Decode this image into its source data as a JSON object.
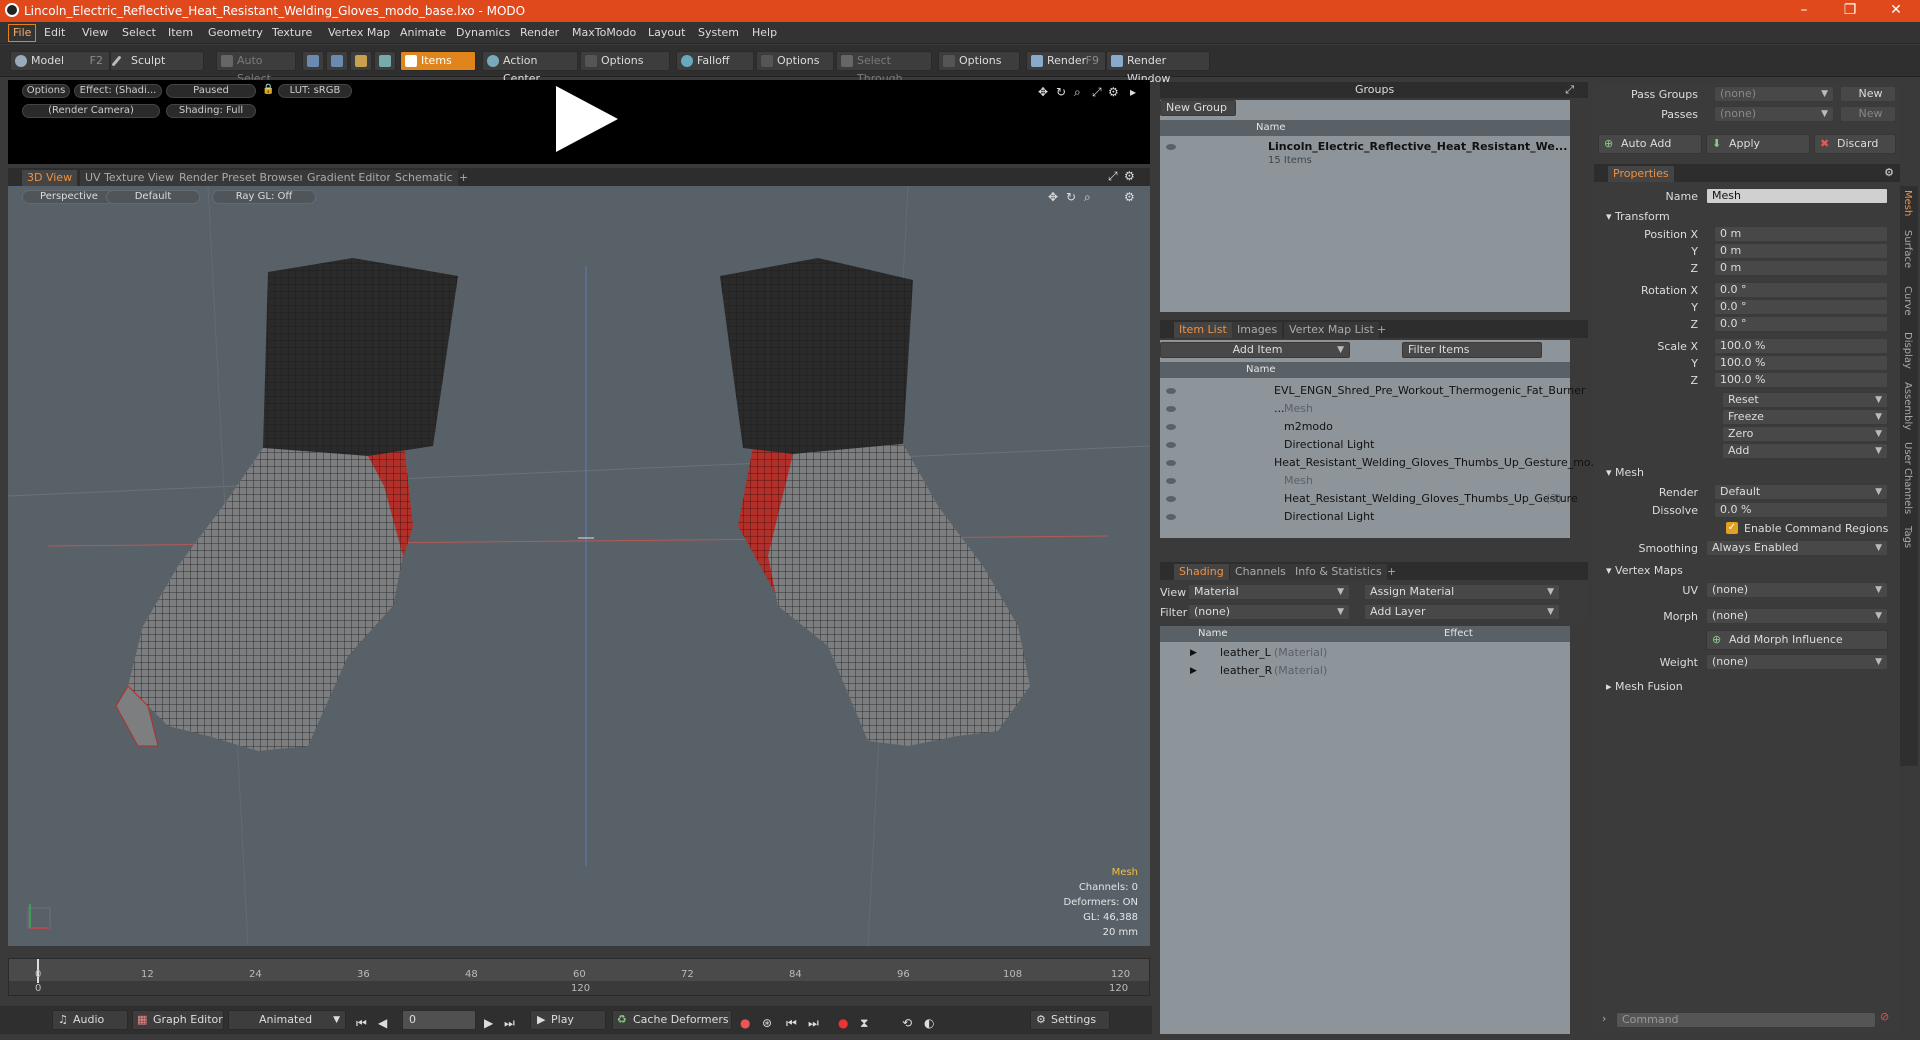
{
  "window": {
    "title": "Lincoln_Electric_Reflective_Heat_Resistant_Welding_Gloves_modo_base.lxo - MODO"
  },
  "menus": [
    "File",
    "Edit",
    "View",
    "Select",
    "Item",
    "Geometry",
    "Texture",
    "Vertex Map",
    "Animate",
    "Dynamics",
    "Render",
    "MaxToModo",
    "Layout",
    "System",
    "Help"
  ],
  "toolbar": {
    "model": "Model",
    "model_key": "F2",
    "sculpt": "Sculpt",
    "auto_select": "Auto Select",
    "items": "Items",
    "action_center": "Action Center",
    "options1": "Options",
    "falloff": "Falloff",
    "options2": "Options",
    "select_through": "Select Through",
    "options3": "Options",
    "render": "Render",
    "render_key": "F9",
    "render_window": "Render Window"
  },
  "preview": {
    "options": "Options",
    "effect": "Effect: (Shadi...",
    "paused": "Paused",
    "lut": "LUT: sRGB",
    "camera": "(Render Camera)",
    "shading": "Shading: Full"
  },
  "view_tabs": [
    "3D View",
    "UV Texture View",
    "Render Preset Browser",
    "Gradient Editor",
    "Schematic",
    "+"
  ],
  "viewport": {
    "perspective": "Perspective",
    "default": "Default",
    "raygl": "Ray GL: Off",
    "info": {
      "title": "Mesh",
      "channels": "Channels: 0",
      "deformers": "Deformers: ON",
      "gl": "GL: 46,388",
      "scale": "20 mm"
    }
  },
  "timeline": {
    "ticks": [
      "0",
      "12",
      "24",
      "36",
      "48",
      "60",
      "72",
      "84",
      "96",
      "108",
      "120"
    ],
    "sub_ticks": [
      "0",
      "120",
      "120"
    ]
  },
  "transport": {
    "audio": "Audio",
    "graph_editor": "Graph Editor",
    "animated": "Animated",
    "frame": "0",
    "play": "Play",
    "cache_deformers": "Cache Deformers",
    "settings": "Settings"
  },
  "groups": {
    "header": "Groups",
    "new_group": "New Group",
    "col_name": "Name",
    "item_name": "Lincoln_Electric_Reflective_Heat_Resistant_We...",
    "item_count": "15 Items"
  },
  "itemlist": {
    "tabs": [
      "Item List",
      "Images",
      "Vertex Map List",
      "+"
    ],
    "add_item": "Add Item",
    "filter": "Filter Items",
    "col_name": "Name",
    "rows": [
      {
        "label": "EVL_ENGN_Shred_Pre_Workout_Thermogenic_Fat_Burner ...",
        "dim": false
      },
      {
        "label": "Mesh",
        "dim": true
      },
      {
        "label": "m2modo",
        "dim": false
      },
      {
        "label": "Directional Light",
        "dim": false
      },
      {
        "label": "Heat_Resistant_Welding_Gloves_Thumbs_Up_Gesture_mo...",
        "dim": false
      },
      {
        "label": "Mesh",
        "dim": true
      },
      {
        "label": "Heat_Resistant_Welding_Gloves_Thumbs_Up_Gesture",
        "dim": false,
        "suffix": "(3)"
      },
      {
        "label": "Directional Light",
        "dim": false
      }
    ]
  },
  "shading": {
    "tabs": [
      "Shading",
      "Channels",
      "Info & Statistics",
      "+"
    ],
    "view_label": "View",
    "view_value": "Material",
    "assign": "Assign Material",
    "filter_label": "Filter",
    "filter_value": "(none)",
    "add_layer": "Add Layer",
    "col_name": "Name",
    "col_effect": "Effect",
    "rows": [
      {
        "label": "leather_L",
        "type": "(Material)"
      },
      {
        "label": "leather_R",
        "type": "(Material)"
      }
    ]
  },
  "props": {
    "pass_groups": "Pass Groups",
    "passes": "Passes",
    "none": "(none)",
    "new": "New",
    "auto_add": "Auto Add",
    "apply": "Apply",
    "discard": "Discard",
    "tab": "Properties",
    "name_label": "Name",
    "name_value": "Mesh",
    "transform": "Transform",
    "position": "Position X",
    "rotation": "Rotation X",
    "scale": "Scale X",
    "y": "Y",
    "z": "Z",
    "pos_vals": [
      "0 m",
      "0 m",
      "0 m"
    ],
    "rot_vals": [
      "0.0 °",
      "0.0 °",
      "0.0 °"
    ],
    "scale_vals": [
      "100.0 %",
      "100.0 %",
      "100.0 %"
    ],
    "reset": "Reset",
    "freeze": "Freeze",
    "zero": "Zero",
    "add": "Add",
    "mesh": "Mesh",
    "render_label": "Render",
    "render_value": "Default",
    "dissolve_label": "Dissolve",
    "dissolve_value": "0.0 %",
    "enable_cmd": "Enable Command Regions",
    "smoothing_label": "Smoothing",
    "smoothing_value": "Always Enabled",
    "vertex_maps": "Vertex Maps",
    "uv": "UV",
    "morph": "Morph",
    "weight": "Weight",
    "add_morph": "Add Morph Influence",
    "mesh_fusion": "Mesh Fusion",
    "command": "Command"
  },
  "side_tabs": [
    "Mesh",
    "Surface",
    "Curve",
    "Display",
    "Assembly",
    "User Channels",
    "Tags"
  ]
}
